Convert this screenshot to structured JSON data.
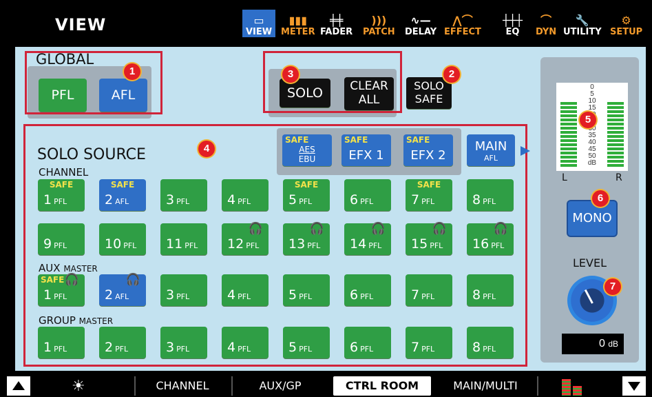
{
  "header": {
    "title": "VIEW",
    "nav": [
      {
        "label": "VIEW",
        "icon": "view-icon",
        "color": "#ffffff"
      },
      {
        "label": "METER",
        "icon": "meter-icon",
        "color": "#f39a2b"
      },
      {
        "label": "FADER",
        "icon": "fader-icon",
        "color": "#ffffff"
      },
      {
        "label": "PATCH",
        "icon": "patch-icon",
        "color": "#f39a2b"
      },
      {
        "label": "DELAY",
        "icon": "delay-icon",
        "color": "#ffffff"
      },
      {
        "label": "EFFECT",
        "icon": "effect-icon",
        "color": "#f39a2b"
      },
      {
        "label": "EQ",
        "icon": "eq-icon",
        "color": "#ffffff"
      },
      {
        "label": "DYN",
        "icon": "dyn-icon",
        "color": "#f39a2b"
      },
      {
        "label": "UTILITY",
        "icon": "utility-icon",
        "color": "#ffffff"
      },
      {
        "label": "SETUP",
        "icon": "setup-icon",
        "color": "#f39a2b"
      }
    ]
  },
  "global": {
    "label": "GLOBAL",
    "pfl": "PFL",
    "afl": "AFL"
  },
  "solo_controls": {
    "solo": "SOLO",
    "clear_all_1": "CLEAR",
    "clear_all_2": "ALL",
    "solo_safe_1": "SOLO",
    "solo_safe_2": "SAFE"
  },
  "solo_source": {
    "title": "SOLO SOURCE",
    "channel_label": "CHANNEL",
    "aux_label": "AUX",
    "aux_sub": "MASTER",
    "group_label": "GROUP",
    "group_sub": "MASTER",
    "sources": {
      "aes_safe": "SAFE",
      "aes_1": "AES",
      "aes_2": "EBU",
      "efx1_safe": "SAFE",
      "efx1": "EFX 1",
      "efx2_safe": "SAFE",
      "efx2": "EFX 2",
      "main": "MAIN",
      "main_sub": "AFL"
    },
    "channels": [
      {
        "num": "1",
        "mode": "PFL",
        "safe": "SAFE",
        "color": "green",
        "hp": false
      },
      {
        "num": "2",
        "mode": "AFL",
        "safe": "SAFE",
        "color": "blue",
        "hp": false
      },
      {
        "num": "3",
        "mode": "PFL",
        "safe": "",
        "color": "green",
        "hp": false
      },
      {
        "num": "4",
        "mode": "PFL",
        "safe": "",
        "color": "green",
        "hp": false
      },
      {
        "num": "5",
        "mode": "PFL",
        "safe": "SAFE",
        "color": "green",
        "hp": false
      },
      {
        "num": "6",
        "mode": "PFL",
        "safe": "",
        "color": "green",
        "hp": false
      },
      {
        "num": "7",
        "mode": "PFL",
        "safe": "SAFE",
        "color": "green",
        "hp": false
      },
      {
        "num": "8",
        "mode": "PFL",
        "safe": "",
        "color": "green",
        "hp": false
      },
      {
        "num": "9",
        "mode": "PFL",
        "safe": "",
        "color": "green",
        "hp": false
      },
      {
        "num": "10",
        "mode": "PFL",
        "safe": "",
        "color": "green",
        "hp": false
      },
      {
        "num": "11",
        "mode": "PFL",
        "safe": "",
        "color": "green",
        "hp": false
      },
      {
        "num": "12",
        "mode": "PFL",
        "safe": "",
        "color": "green",
        "hp": true
      },
      {
        "num": "13",
        "mode": "PFL",
        "safe": "",
        "color": "green",
        "hp": true
      },
      {
        "num": "14",
        "mode": "PFL",
        "safe": "",
        "color": "green",
        "hp": true
      },
      {
        "num": "15",
        "mode": "PFL",
        "safe": "",
        "color": "green",
        "hp": true
      },
      {
        "num": "16",
        "mode": "PFL",
        "safe": "",
        "color": "green",
        "hp": true
      }
    ],
    "aux": [
      {
        "num": "1",
        "mode": "PFL",
        "safe": "SAFE",
        "color": "green",
        "hp": true
      },
      {
        "num": "2",
        "mode": "AFL",
        "safe": "",
        "color": "blue",
        "hp": true
      },
      {
        "num": "3",
        "mode": "PFL",
        "safe": "",
        "color": "green",
        "hp": false
      },
      {
        "num": "4",
        "mode": "PFL",
        "safe": "",
        "color": "green",
        "hp": false
      },
      {
        "num": "5",
        "mode": "PFL",
        "safe": "",
        "color": "green",
        "hp": false
      },
      {
        "num": "6",
        "mode": "PFL",
        "safe": "",
        "color": "green",
        "hp": false
      },
      {
        "num": "7",
        "mode": "PFL",
        "safe": "",
        "color": "green",
        "hp": false
      },
      {
        "num": "8",
        "mode": "PFL",
        "safe": "",
        "color": "green",
        "hp": false
      }
    ],
    "groups": [
      {
        "num": "1",
        "mode": "PFL",
        "safe": "",
        "color": "green",
        "hp": false
      },
      {
        "num": "2",
        "mode": "PFL",
        "safe": "",
        "color": "green",
        "hp": false
      },
      {
        "num": "3",
        "mode": "PFL",
        "safe": "",
        "color": "green",
        "hp": false
      },
      {
        "num": "4",
        "mode": "PFL",
        "safe": "",
        "color": "green",
        "hp": false
      },
      {
        "num": "5",
        "mode": "PFL",
        "safe": "",
        "color": "green",
        "hp": false
      },
      {
        "num": "6",
        "mode": "PFL",
        "safe": "",
        "color": "green",
        "hp": false
      },
      {
        "num": "7",
        "mode": "PFL",
        "safe": "",
        "color": "green",
        "hp": false
      },
      {
        "num": "8",
        "mode": "PFL",
        "safe": "",
        "color": "green",
        "hp": false
      }
    ]
  },
  "meter": {
    "scale": [
      "0",
      "5",
      "10",
      "15",
      "20",
      "25",
      "30",
      "35",
      "40",
      "45",
      "50"
    ],
    "unit": "dB",
    "left": "L",
    "right": "R"
  },
  "mono": "MONO",
  "level": {
    "label": "LEVEL",
    "value": "0",
    "unit": "dB"
  },
  "badges": [
    "1",
    "2",
    "3",
    "4",
    "5",
    "6",
    "7"
  ],
  "bottom": {
    "tabs": [
      "CHANNEL",
      "AUX/GP",
      "CTRL ROOM",
      "MAIN/MULTI"
    ],
    "active_tab": "CTRL ROOM"
  }
}
